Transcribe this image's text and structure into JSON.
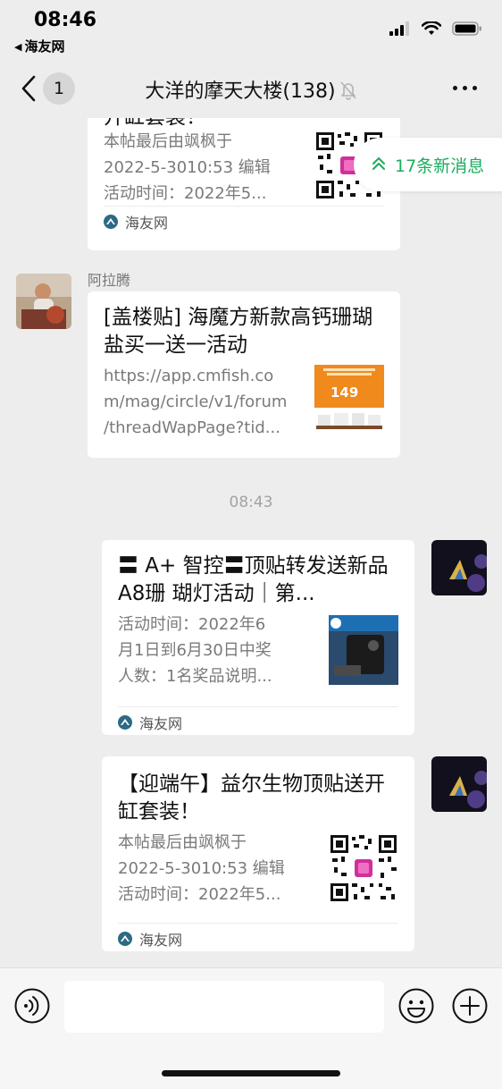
{
  "status_bar": {
    "time": "08:46",
    "back_app": "海友网",
    "icons": [
      "signal-icon",
      "wifi-icon",
      "battery-icon"
    ]
  },
  "nav": {
    "unread_count": "1",
    "title": "大洋的摩天大楼(138)",
    "mute_icon": "bell-off-icon",
    "more_icon": "more-icon"
  },
  "new_messages": {
    "label": "17条新消息"
  },
  "messages": [
    {
      "side": "left",
      "partial": true,
      "title": "开缸套装！",
      "desc": [
        "本帖最后由飒枫于",
        "2022-5-3010:53 编辑",
        "活动时间：2022年5..."
      ],
      "source": "海友网",
      "thumb": "qr-code"
    },
    {
      "side": "left",
      "sender": "阿拉腾",
      "title": "[盖楼贴] 海魔方新款高钙珊瑚盐买一送一活动",
      "desc": [
        "https://app.cmfish.co",
        "m/mag/circle/v1/forum",
        "/threadWapPage?tid..."
      ],
      "thumb": "product-ad",
      "thumb_price": "149"
    },
    {
      "timestamp": "08:43"
    },
    {
      "side": "right",
      "title": "〓 A+ 智控〓顶贴转发送新品 A8珊 瑚灯活动｜第...",
      "desc": [
        "活动时间：2022年6",
        "月1日到6月30日中奖",
        "人数：1名奖品说明..."
      ],
      "source": "海友网",
      "thumb": "device-product"
    },
    {
      "side": "right",
      "title": "【迎端午】益尔生物顶贴送开缸套装！",
      "desc": [
        "本帖最后由飒枫于",
        "2022-5-3010:53 编辑",
        "活动时间：2022年5..."
      ],
      "source": "海友网",
      "thumb": "qr-code"
    }
  ],
  "input_bar": {
    "voice_icon": "voice-icon",
    "input_value": "",
    "emoji_icon": "emoji-icon",
    "plus_icon": "plus-icon"
  },
  "colors": {
    "background": "#ededed",
    "accent_green": "#1aad5d",
    "card": "#ffffff"
  }
}
